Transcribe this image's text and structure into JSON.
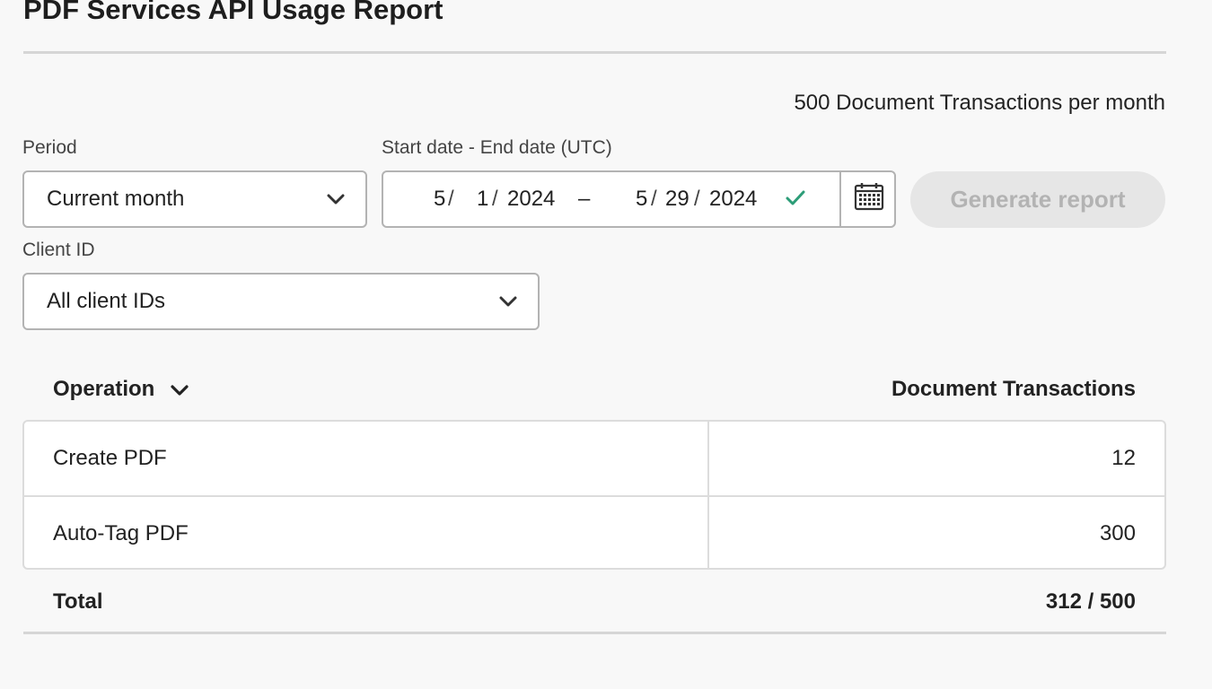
{
  "header": {
    "title": "PDF Services API Usage Report",
    "quota": "500 Document Transactions per month"
  },
  "filters": {
    "period_label": "Period",
    "period_value": "Current month",
    "date_label": "Start date - End date (UTC)",
    "start_month": "5",
    "start_day": "1",
    "start_year": "2024",
    "range_separator": "–",
    "end_month": "5",
    "end_day": "29",
    "end_year": "2024",
    "client_label": "Client ID",
    "client_value": "All client IDs",
    "generate_label": "Generate report"
  },
  "table": {
    "operation_header": "Operation",
    "transactions_header": "Document Transactions",
    "rows": [
      {
        "operation": "Create PDF",
        "transactions": "12"
      },
      {
        "operation": "Auto-Tag PDF",
        "transactions": "300"
      }
    ],
    "total_label": "Total",
    "total_value": "312 / 500"
  },
  "icons": {
    "period_dropdown": "chevron-down-icon",
    "client_dropdown": "chevron-down-icon",
    "sort": "chevron-down-icon",
    "valid": "checkmark-icon",
    "calendar": "calendar-icon"
  },
  "colors": {
    "valid_check": "#2d9d78",
    "button_disabled_bg": "#e6e6e6",
    "button_disabled_text": "#b3b3b3"
  }
}
